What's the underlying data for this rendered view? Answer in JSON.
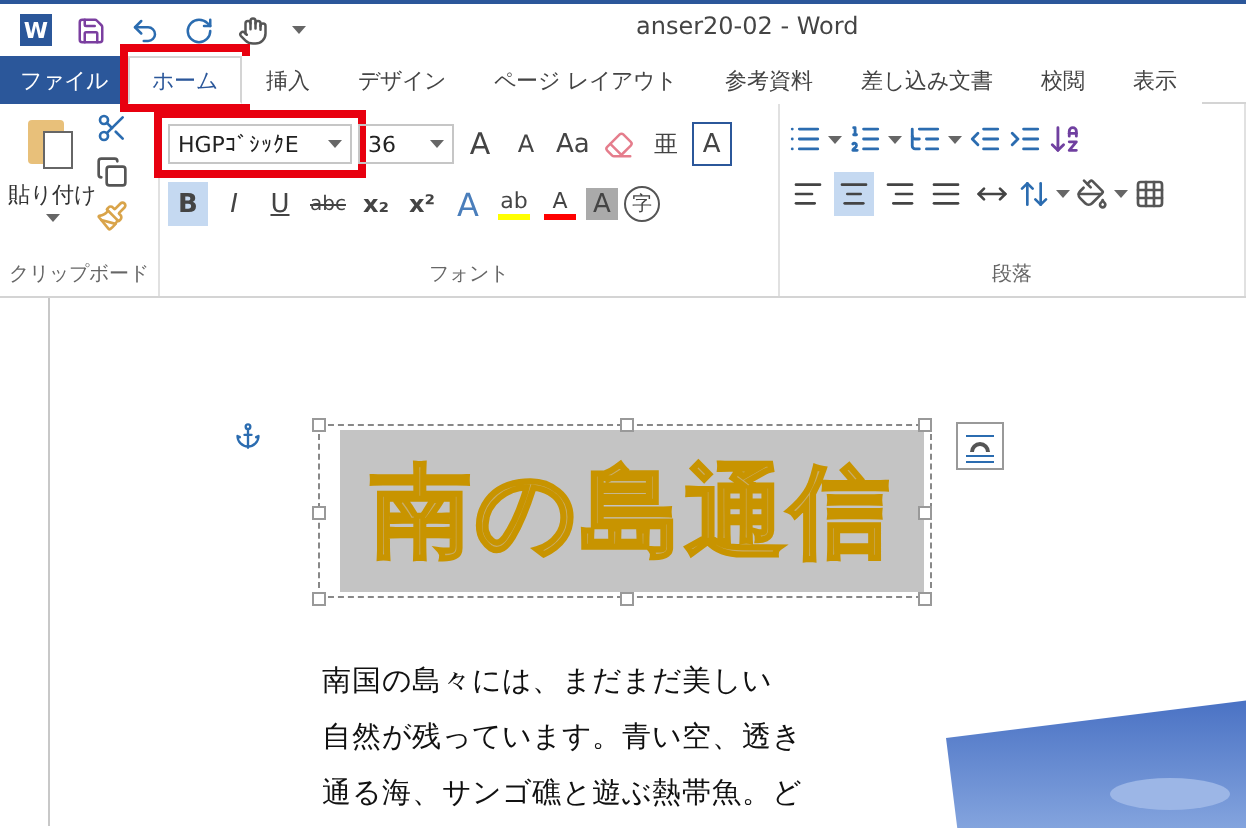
{
  "window": {
    "title": "anser20-02 - Word",
    "app_glyph": "W"
  },
  "tabs": [
    {
      "label": "ファイル",
      "kind": "file",
      "selected": false,
      "highlighted": false
    },
    {
      "label": "ホーム",
      "kind": "tab",
      "selected": true,
      "highlighted": true
    },
    {
      "label": "挿入",
      "kind": "tab",
      "selected": false,
      "highlighted": false
    },
    {
      "label": "デザイン",
      "kind": "tab",
      "selected": false,
      "highlighted": false
    },
    {
      "label": "ページ レイアウト",
      "kind": "tab",
      "selected": false,
      "highlighted": false
    },
    {
      "label": "参考資料",
      "kind": "tab",
      "selected": false,
      "highlighted": false
    },
    {
      "label": "差し込み文書",
      "kind": "tab",
      "selected": false,
      "highlighted": false
    },
    {
      "label": "校閲",
      "kind": "tab",
      "selected": false,
      "highlighted": false
    },
    {
      "label": "表示",
      "kind": "tab",
      "selected": false,
      "highlighted": false
    }
  ],
  "clipboard": {
    "paste_label": "貼り付け",
    "group_label": "クリップボード"
  },
  "font": {
    "font_name": "HGPｺﾞｼｯｸE",
    "font_size": "36",
    "highlighted": true,
    "group_label": "フォント",
    "row1": [
      {
        "glyph": "A",
        "kind": "grow"
      },
      {
        "glyph": "A",
        "kind": "shrink"
      },
      {
        "glyph": "Aa",
        "kind": "case"
      },
      {
        "kind": "eraser"
      },
      {
        "glyph": "亜",
        "kind": "ruby"
      },
      {
        "glyph": "A",
        "kind": "boxed"
      }
    ],
    "row2": [
      {
        "glyph": "B",
        "kind": "bold",
        "selected": true
      },
      {
        "glyph": "I",
        "kind": "italic",
        "selected": false
      },
      {
        "glyph": "U",
        "kind": "underline",
        "selected": false
      },
      {
        "glyph": "abc",
        "kind": "strike",
        "selected": false
      },
      {
        "glyph": "x₂",
        "kind": "sub",
        "selected": false
      },
      {
        "glyph": "x²",
        "kind": "sup",
        "selected": false
      },
      {
        "glyph": "A",
        "kind": "effect"
      },
      {
        "glyph": "ab",
        "kind": "marker",
        "color": "#ffff00"
      },
      {
        "glyph": "A",
        "kind": "color",
        "color": "#ff0000"
      },
      {
        "glyph": "A",
        "kind": "shade"
      },
      {
        "glyph": "字",
        "kind": "enclose"
      }
    ]
  },
  "paragraph": {
    "group_label": "段落",
    "align": [
      {
        "kind": "left",
        "selected": false
      },
      {
        "kind": "center",
        "selected": true
      },
      {
        "kind": "right",
        "selected": false
      },
      {
        "kind": "justify",
        "selected": false
      },
      {
        "kind": "distribute",
        "selected": false
      }
    ]
  },
  "document": {
    "wordart": "南の島通信",
    "body": [
      "南国の島々には、まだまだ美しい",
      "自然が残っています。青い空、透き",
      "通る海、サンゴ礁と遊ぶ熱帯魚。ど"
    ]
  }
}
